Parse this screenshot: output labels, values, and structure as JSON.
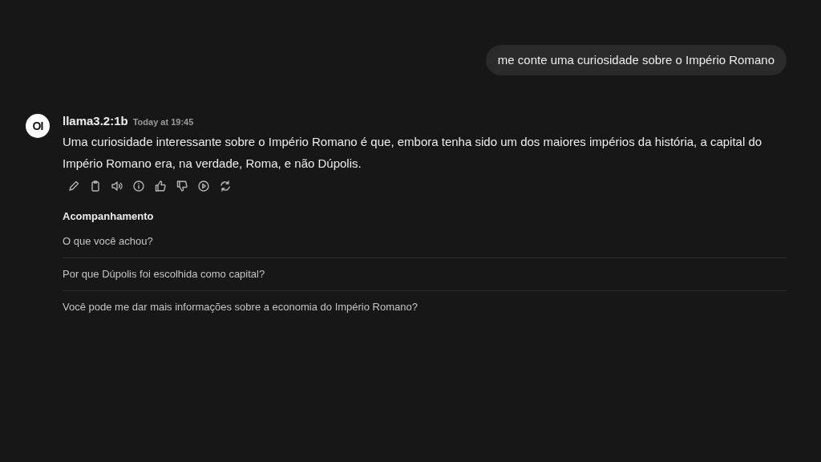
{
  "user_message": "me conte uma curiosidade sobre o Império Romano",
  "assistant": {
    "avatar": "OI",
    "model": "llama3.2:1b",
    "time": "Today at 19:45",
    "text": "Uma curiosidade interessante sobre o Império Romano é que, embora tenha sido um dos maiores impérios da história, a capital do Império Romano era, na verdade, Roma, e não Dúpolis.",
    "actions": [
      {
        "kind": "edit"
      },
      {
        "kind": "copy"
      },
      {
        "kind": "speak"
      },
      {
        "kind": "info"
      },
      {
        "kind": "like"
      },
      {
        "kind": "dislike"
      },
      {
        "kind": "play"
      },
      {
        "kind": "regenerate"
      }
    ]
  },
  "follow_ups": {
    "title": "Acompanhamento",
    "items": [
      "O que você achou?",
      "Por que Dúpolis foi escolhida como capital?",
      "Você pode me dar mais informações sobre a economia do Império Romano?"
    ]
  }
}
